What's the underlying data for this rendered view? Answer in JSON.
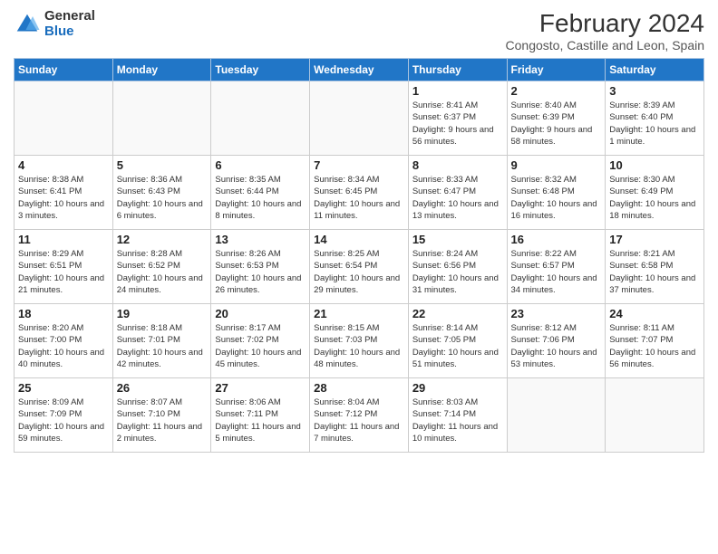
{
  "logo": {
    "general": "General",
    "blue": "Blue"
  },
  "title": "February 2024",
  "subtitle": "Congosto, Castille and Leon, Spain",
  "weekdays": [
    "Sunday",
    "Monday",
    "Tuesday",
    "Wednesday",
    "Thursday",
    "Friday",
    "Saturday"
  ],
  "weeks": [
    [
      {
        "day": "",
        "info": ""
      },
      {
        "day": "",
        "info": ""
      },
      {
        "day": "",
        "info": ""
      },
      {
        "day": "",
        "info": ""
      },
      {
        "day": "1",
        "info": "Sunrise: 8:41 AM\nSunset: 6:37 PM\nDaylight: 9 hours and 56 minutes."
      },
      {
        "day": "2",
        "info": "Sunrise: 8:40 AM\nSunset: 6:39 PM\nDaylight: 9 hours and 58 minutes."
      },
      {
        "day": "3",
        "info": "Sunrise: 8:39 AM\nSunset: 6:40 PM\nDaylight: 10 hours and 1 minute."
      }
    ],
    [
      {
        "day": "4",
        "info": "Sunrise: 8:38 AM\nSunset: 6:41 PM\nDaylight: 10 hours and 3 minutes."
      },
      {
        "day": "5",
        "info": "Sunrise: 8:36 AM\nSunset: 6:43 PM\nDaylight: 10 hours and 6 minutes."
      },
      {
        "day": "6",
        "info": "Sunrise: 8:35 AM\nSunset: 6:44 PM\nDaylight: 10 hours and 8 minutes."
      },
      {
        "day": "7",
        "info": "Sunrise: 8:34 AM\nSunset: 6:45 PM\nDaylight: 10 hours and 11 minutes."
      },
      {
        "day": "8",
        "info": "Sunrise: 8:33 AM\nSunset: 6:47 PM\nDaylight: 10 hours and 13 minutes."
      },
      {
        "day": "9",
        "info": "Sunrise: 8:32 AM\nSunset: 6:48 PM\nDaylight: 10 hours and 16 minutes."
      },
      {
        "day": "10",
        "info": "Sunrise: 8:30 AM\nSunset: 6:49 PM\nDaylight: 10 hours and 18 minutes."
      }
    ],
    [
      {
        "day": "11",
        "info": "Sunrise: 8:29 AM\nSunset: 6:51 PM\nDaylight: 10 hours and 21 minutes."
      },
      {
        "day": "12",
        "info": "Sunrise: 8:28 AM\nSunset: 6:52 PM\nDaylight: 10 hours and 24 minutes."
      },
      {
        "day": "13",
        "info": "Sunrise: 8:26 AM\nSunset: 6:53 PM\nDaylight: 10 hours and 26 minutes."
      },
      {
        "day": "14",
        "info": "Sunrise: 8:25 AM\nSunset: 6:54 PM\nDaylight: 10 hours and 29 minutes."
      },
      {
        "day": "15",
        "info": "Sunrise: 8:24 AM\nSunset: 6:56 PM\nDaylight: 10 hours and 31 minutes."
      },
      {
        "day": "16",
        "info": "Sunrise: 8:22 AM\nSunset: 6:57 PM\nDaylight: 10 hours and 34 minutes."
      },
      {
        "day": "17",
        "info": "Sunrise: 8:21 AM\nSunset: 6:58 PM\nDaylight: 10 hours and 37 minutes."
      }
    ],
    [
      {
        "day": "18",
        "info": "Sunrise: 8:20 AM\nSunset: 7:00 PM\nDaylight: 10 hours and 40 minutes."
      },
      {
        "day": "19",
        "info": "Sunrise: 8:18 AM\nSunset: 7:01 PM\nDaylight: 10 hours and 42 minutes."
      },
      {
        "day": "20",
        "info": "Sunrise: 8:17 AM\nSunset: 7:02 PM\nDaylight: 10 hours and 45 minutes."
      },
      {
        "day": "21",
        "info": "Sunrise: 8:15 AM\nSunset: 7:03 PM\nDaylight: 10 hours and 48 minutes."
      },
      {
        "day": "22",
        "info": "Sunrise: 8:14 AM\nSunset: 7:05 PM\nDaylight: 10 hours and 51 minutes."
      },
      {
        "day": "23",
        "info": "Sunrise: 8:12 AM\nSunset: 7:06 PM\nDaylight: 10 hours and 53 minutes."
      },
      {
        "day": "24",
        "info": "Sunrise: 8:11 AM\nSunset: 7:07 PM\nDaylight: 10 hours and 56 minutes."
      }
    ],
    [
      {
        "day": "25",
        "info": "Sunrise: 8:09 AM\nSunset: 7:09 PM\nDaylight: 10 hours and 59 minutes."
      },
      {
        "day": "26",
        "info": "Sunrise: 8:07 AM\nSunset: 7:10 PM\nDaylight: 11 hours and 2 minutes."
      },
      {
        "day": "27",
        "info": "Sunrise: 8:06 AM\nSunset: 7:11 PM\nDaylight: 11 hours and 5 minutes."
      },
      {
        "day": "28",
        "info": "Sunrise: 8:04 AM\nSunset: 7:12 PM\nDaylight: 11 hours and 7 minutes."
      },
      {
        "day": "29",
        "info": "Sunrise: 8:03 AM\nSunset: 7:14 PM\nDaylight: 11 hours and 10 minutes."
      },
      {
        "day": "",
        "info": ""
      },
      {
        "day": "",
        "info": ""
      }
    ]
  ]
}
